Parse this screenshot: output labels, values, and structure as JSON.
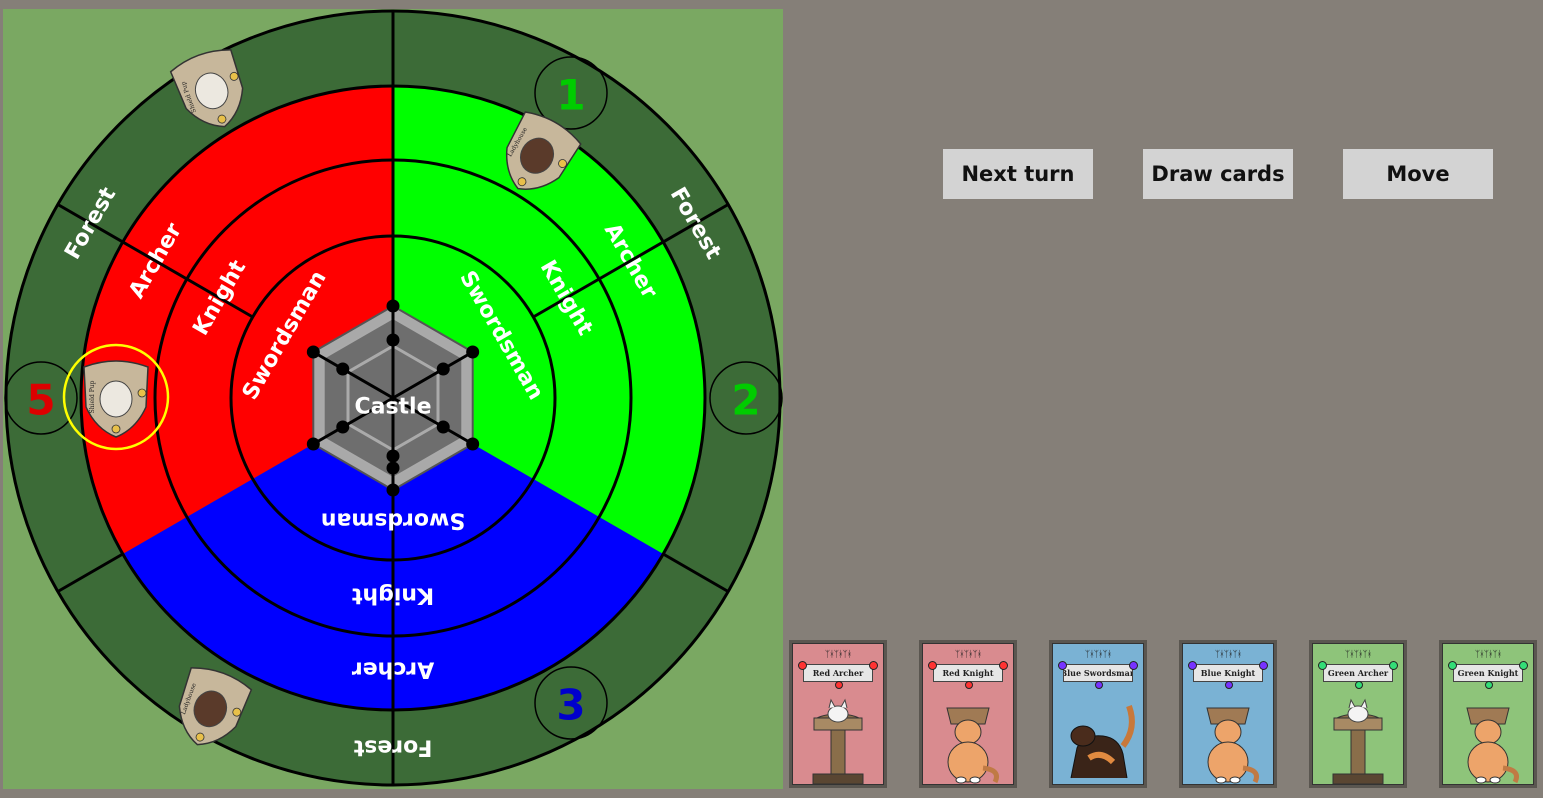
{
  "board": {
    "sectors": [
      {
        "color": "red",
        "fill": "#ff0000",
        "number": "5",
        "number_color": "#dd0000"
      },
      {
        "color": "green",
        "fill": "#00ff00",
        "number": "1",
        "number_color": "#00cc00"
      },
      {
        "color": "green-side",
        "number": "2",
        "number_color": "#00cc00"
      },
      {
        "color": "blue",
        "fill": "#0000ff",
        "number": "3",
        "number_color": "#0000cc"
      }
    ],
    "ring_labels": {
      "castle": "Castle",
      "swordsman": "Swordsman",
      "knight": "Knight",
      "archer": "Archer",
      "forest": "Forest"
    },
    "colors": {
      "forest_ring": "#3c6b37",
      "board_bg": "#7aa862",
      "castle": "#6e6e6e",
      "selection": "#ffff00"
    },
    "tokens": [
      {
        "name": "Shield Pup",
        "icon": "dog-token-icon"
      },
      {
        "name": "Ladyhouse",
        "icon": "cat-token-icon"
      },
      {
        "name": "Shield Pup",
        "icon": "dog-token-icon",
        "selected": true
      },
      {
        "name": "Ladyhouse",
        "icon": "cat-token-icon"
      }
    ]
  },
  "controls": {
    "next_turn": "Next turn",
    "draw_cards": "Draw cards",
    "move": "Move"
  },
  "hand": [
    {
      "title": "Red Archer",
      "bg": "#d98b8f",
      "dot": "#ff3333",
      "art": "white-cat-tower-icon"
    },
    {
      "title": "Red Knight",
      "bg": "#d98b8f",
      "dot": "#ff3333",
      "art": "box-cat-icon"
    },
    {
      "title": "Blue Swordsman",
      "bg": "#7ab2d4",
      "dot": "#7733ff",
      "art": "tortie-cat-icon"
    },
    {
      "title": "Blue Knight",
      "bg": "#7ab2d4",
      "dot": "#7733ff",
      "art": "box-cat-icon"
    },
    {
      "title": "Green Archer",
      "bg": "#8ec47a",
      "dot": "#33dd77",
      "art": "white-cat-tower-icon"
    },
    {
      "title": "Green Knight",
      "bg": "#8ec47a",
      "dot": "#33dd77",
      "art": "box-cat-icon"
    }
  ],
  "card_header": "ᛉᚼᛉᚼᛉᚼ"
}
